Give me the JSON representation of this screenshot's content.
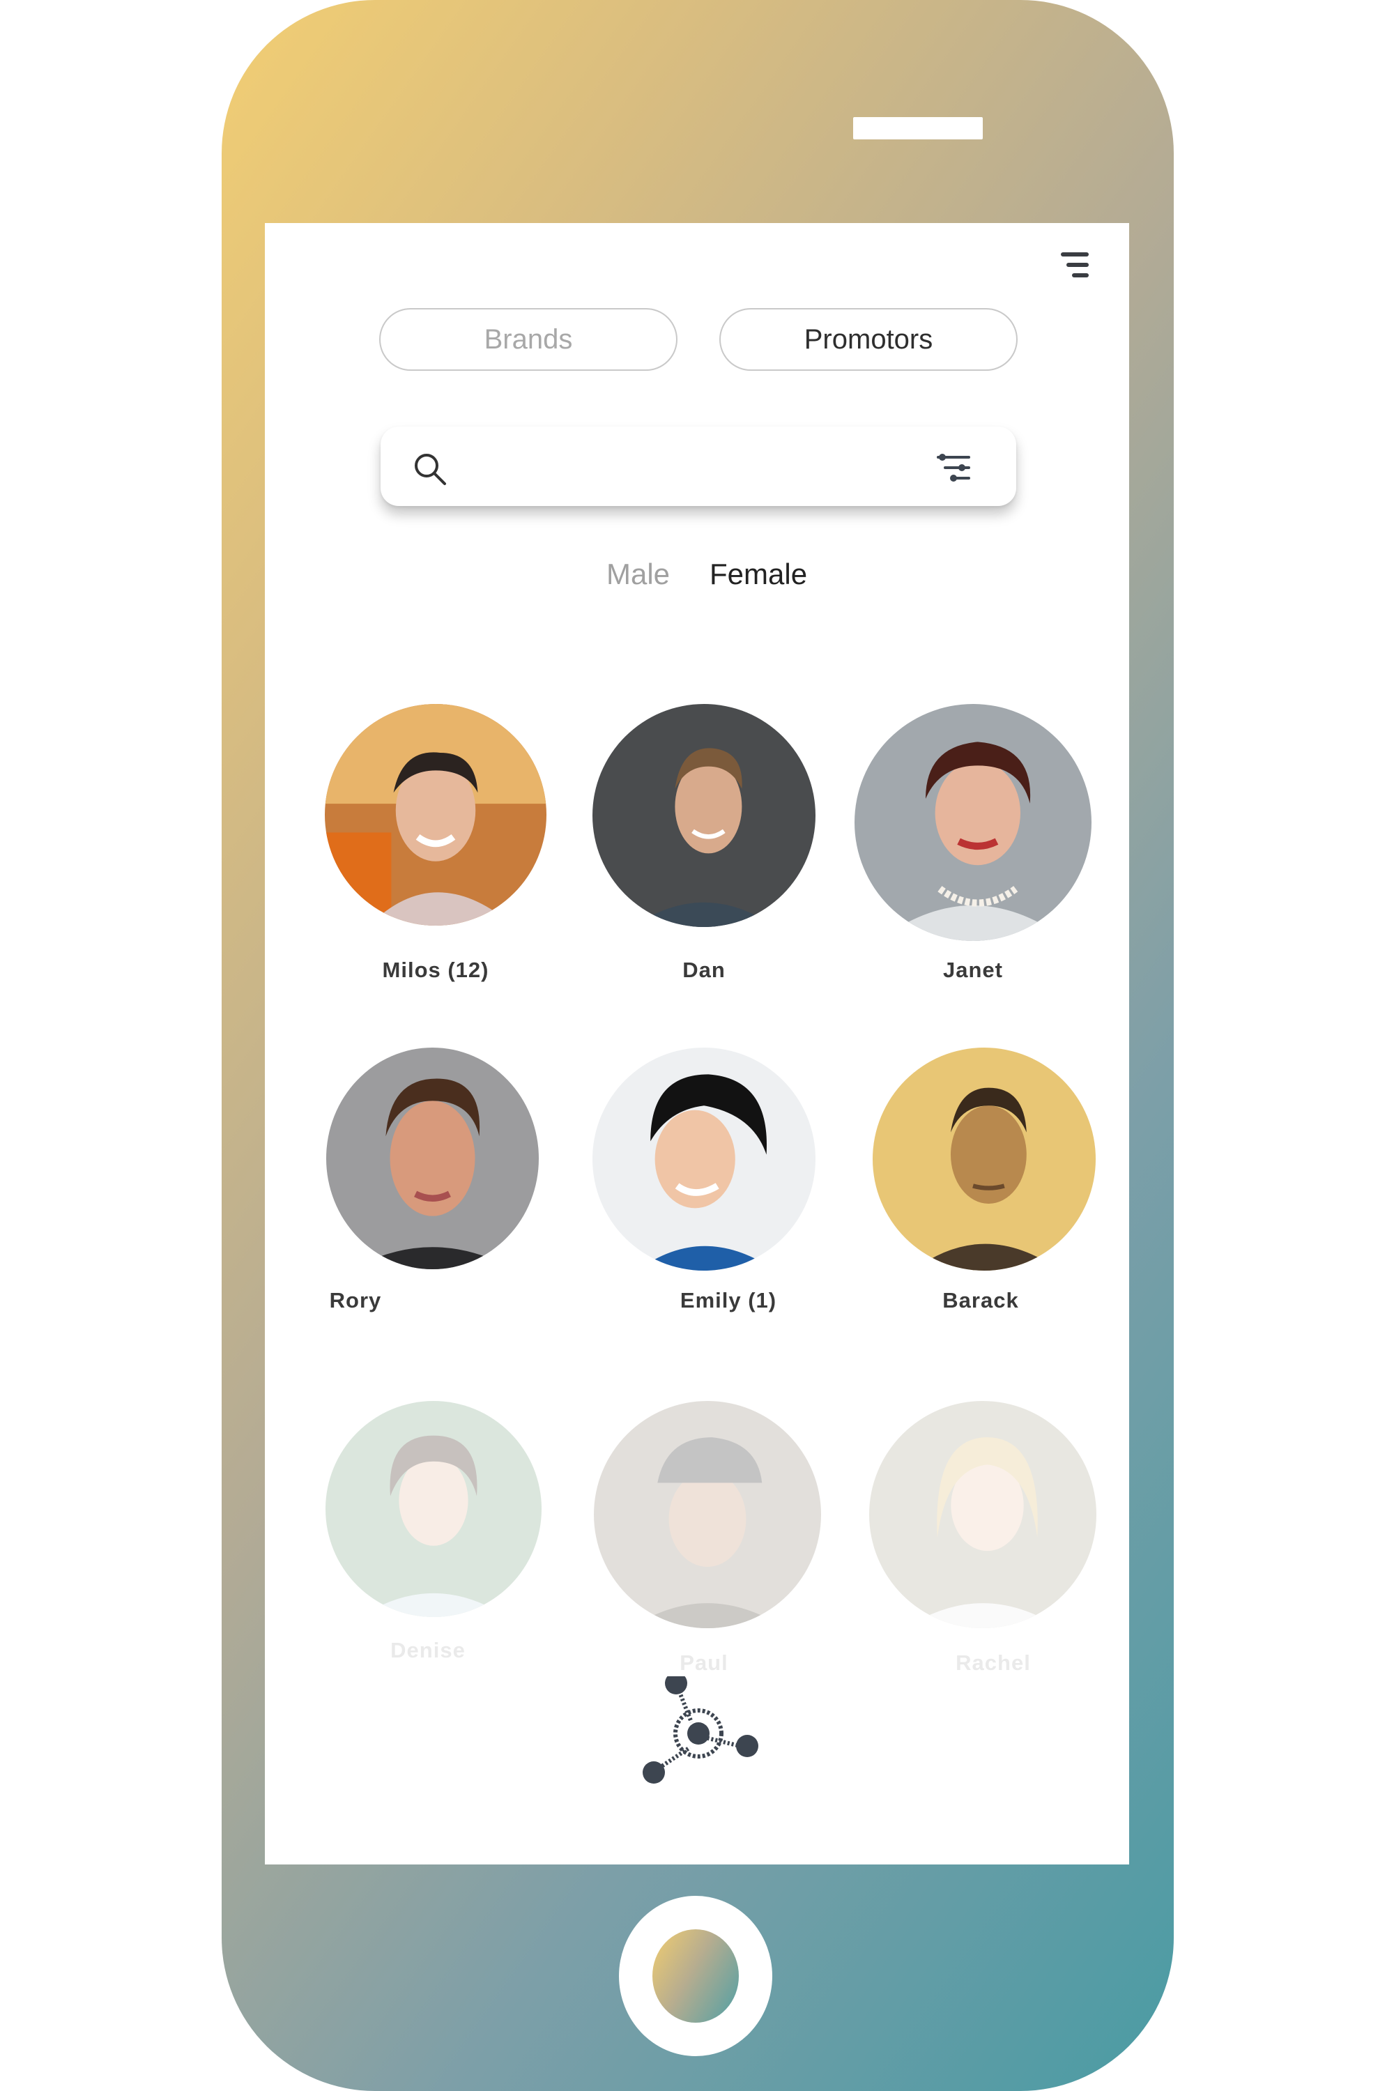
{
  "app": {
    "tabs": {
      "brands": "Brands",
      "promotors": "Promotors",
      "active": "Promotors"
    },
    "search": {
      "placeholder": ""
    },
    "gender_filter": {
      "male": "Male",
      "female": "Female",
      "active": "Female"
    },
    "people": [
      {
        "name": "Milos (12)",
        "state": "active"
      },
      {
        "name": "Dan",
        "state": "active"
      },
      {
        "name": "Janet",
        "state": "active"
      },
      {
        "name": "Rory",
        "state": "active"
      },
      {
        "name": "Emily (1)",
        "state": "active"
      },
      {
        "name": "Barack",
        "state": "active"
      },
      {
        "name": "Denise",
        "state": "faded"
      },
      {
        "name": "Paul",
        "state": "faded"
      },
      {
        "name": "Rachel",
        "state": "faded"
      }
    ]
  },
  "icons": {
    "menu": "hamburger-menu-icon",
    "search": "magnifier-icon",
    "filter": "sliders-filter-icon",
    "hub": "network-hub-icon"
  },
  "colors": {
    "phone_gradient_start": "#f2ce73",
    "phone_gradient_end": "#4a9ba4",
    "text_dark": "#2e2e2e",
    "text_muted": "#a8a8a8",
    "icon_dark": "#3d4550"
  }
}
